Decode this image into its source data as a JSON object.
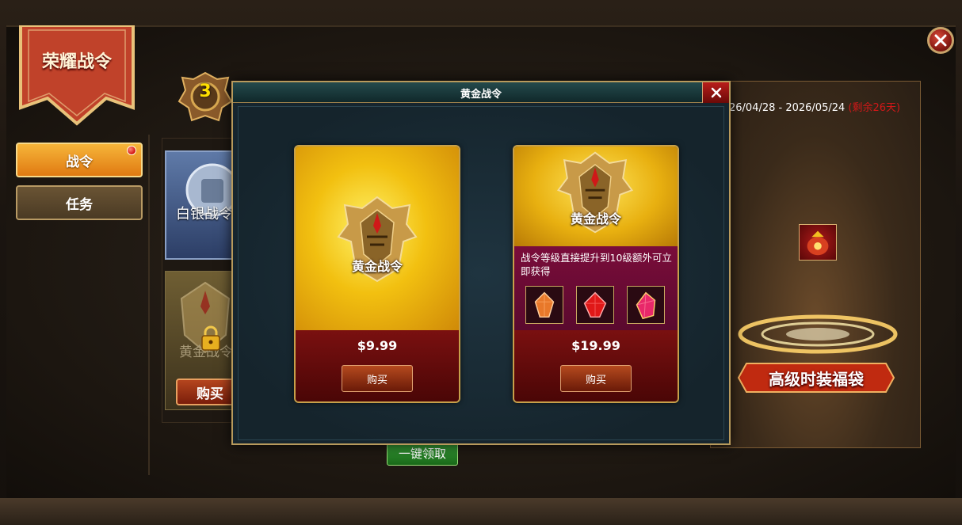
{
  "title": "荣耀战令",
  "sidebar": {
    "items": [
      {
        "label": "战令",
        "active": true,
        "has_badge": true
      },
      {
        "label": "任务",
        "active": false
      }
    ]
  },
  "level": "3",
  "background": {
    "silver_pass_label": "白银战令",
    "gold_pass_label": "黄金战令",
    "buy_label": "购买",
    "claim_all_label": "一键领取",
    "date_range": "26/04/28  - 2026/05/24",
    "remaining": "(剩余26天)",
    "reward_label": "高级时装福袋"
  },
  "modal": {
    "title": "黄金战令",
    "cards": [
      {
        "name": "黄金战令",
        "price": "$9.99",
        "buy_label": "购买"
      },
      {
        "name": "黄金战令",
        "description": "战令等级直接提升到10级额外可立即获得",
        "price": "$19.99",
        "buy_label": "购买",
        "gems": [
          "orange-gem-icon",
          "red-gem-icon",
          "ruby-gem-icon"
        ]
      }
    ]
  },
  "colors": {
    "accent_gold": "#f2c010",
    "modal_bg": "#16252e",
    "buy_button": "#b54a1e",
    "remaining_text": "#d01818",
    "claim_button": "#3aa33a"
  }
}
